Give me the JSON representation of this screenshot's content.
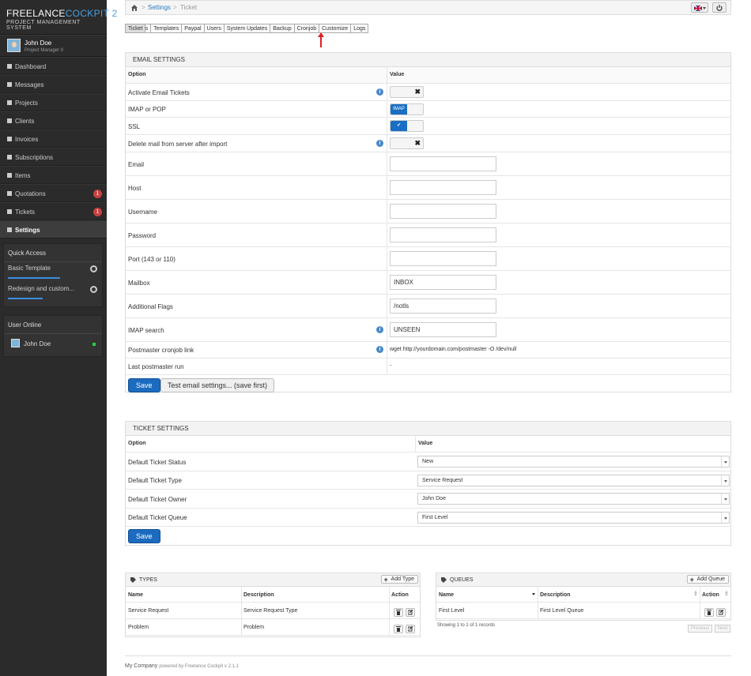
{
  "app": {
    "brand_primary": "FREELANCE",
    "brand_secondary": "COCKPIT 2",
    "subtitle": "PROJECT MANAGEMENT SYSTEM"
  },
  "user": {
    "name": "John Doe",
    "role": "Project Manager II"
  },
  "nav": [
    {
      "label": "Dashboard",
      "icon": "grid-icon"
    },
    {
      "label": "Messages",
      "icon": "inbox-icon"
    },
    {
      "label": "Projects",
      "icon": "briefcase-icon"
    },
    {
      "label": "Clients",
      "icon": "user-icon"
    },
    {
      "label": "Invoices",
      "icon": "list-icon"
    },
    {
      "label": "Subscriptions",
      "icon": "list-icon"
    },
    {
      "label": "Items",
      "icon": "file-icon"
    },
    {
      "label": "Quotations",
      "icon": "calculator-icon",
      "badge": "1"
    },
    {
      "label": "Tickets",
      "icon": "tag-icon",
      "badge": "1"
    },
    {
      "label": "Settings",
      "icon": "gear-icon",
      "active": true
    }
  ],
  "quick_access": {
    "title": "Quick Access",
    "items": [
      {
        "label": "Basic Template",
        "progress": 0.75
      },
      {
        "label": "Redesign and custom...",
        "progress": 0.5
      }
    ]
  },
  "user_online": {
    "title": "User Online",
    "users": [
      {
        "name": "John Doe"
      }
    ]
  },
  "breadcrumb": {
    "parent": "Settings",
    "current": "Ticket"
  },
  "tabs": [
    "Settings",
    "Templates",
    "Paypal",
    "Users",
    "System Updates",
    "Backup",
    "Cronjob",
    "Ticket",
    "Customize",
    "Logs"
  ],
  "email_settings": {
    "title": "EMAIL SETTINGS",
    "col_option": "Option",
    "col_value": "Value",
    "rows": {
      "activate": "Activate Email Tickets",
      "imap_pop": "IMAP or POP",
      "imap_toggle": "IMAP",
      "ssl": "SSL",
      "delete_mail": "Delete mail from server after import",
      "email": "Email",
      "host": "Host",
      "username": "Username",
      "password": "Password",
      "port": "Port (143 or 110)",
      "mailbox": "Mailbox",
      "mailbox_value": "INBOX",
      "flags": "Additional Flags",
      "flags_value": "/notls",
      "imap_search": "IMAP search",
      "imap_search_value": "UNSEEN",
      "postmaster_link": "Postmaster cronjob link",
      "postmaster_link_value": "wget http://yourdomain.com/postmaster -O /dev/null",
      "last_run": "Last postmaster run",
      "last_run_value": "-"
    },
    "save": "Save",
    "test": "Test email settings... (save first)"
  },
  "ticket_settings": {
    "title": "TICKET SETTINGS",
    "col_option": "Option",
    "col_value": "Value",
    "rows": [
      {
        "label": "Default Ticket Status",
        "value": "New"
      },
      {
        "label": "Default Ticket Type",
        "value": "Service Request"
      },
      {
        "label": "Default Ticket Owner",
        "value": "John Doe"
      },
      {
        "label": "Default Ticket Queue",
        "value": "First Level"
      }
    ],
    "save": "Save"
  },
  "types": {
    "title": "TYPES",
    "add": "Add Type",
    "cols": [
      "Name",
      "Description",
      "Action"
    ],
    "rows": [
      {
        "name": "Service Request",
        "desc": "Service Request Type"
      },
      {
        "name": "Problem",
        "desc": "Problem"
      }
    ]
  },
  "queues": {
    "title": "QUEUES",
    "add": "Add Queue",
    "cols": [
      "Name",
      "Description",
      "Action"
    ],
    "rows": [
      {
        "name": "First Level",
        "desc": "First Level Queue"
      }
    ],
    "info": "Showing 1 to 1 of 1 records",
    "prev": "Previous",
    "next": "Next"
  },
  "footer": {
    "company": "My Company",
    "powered": "powered by Freelance Cockpit v 2.1.1"
  },
  "colors": {
    "accent": "#1c6bbf",
    "sidebar": "#2b2b2b",
    "badge": "#c94040",
    "arrow": "#e02020"
  }
}
